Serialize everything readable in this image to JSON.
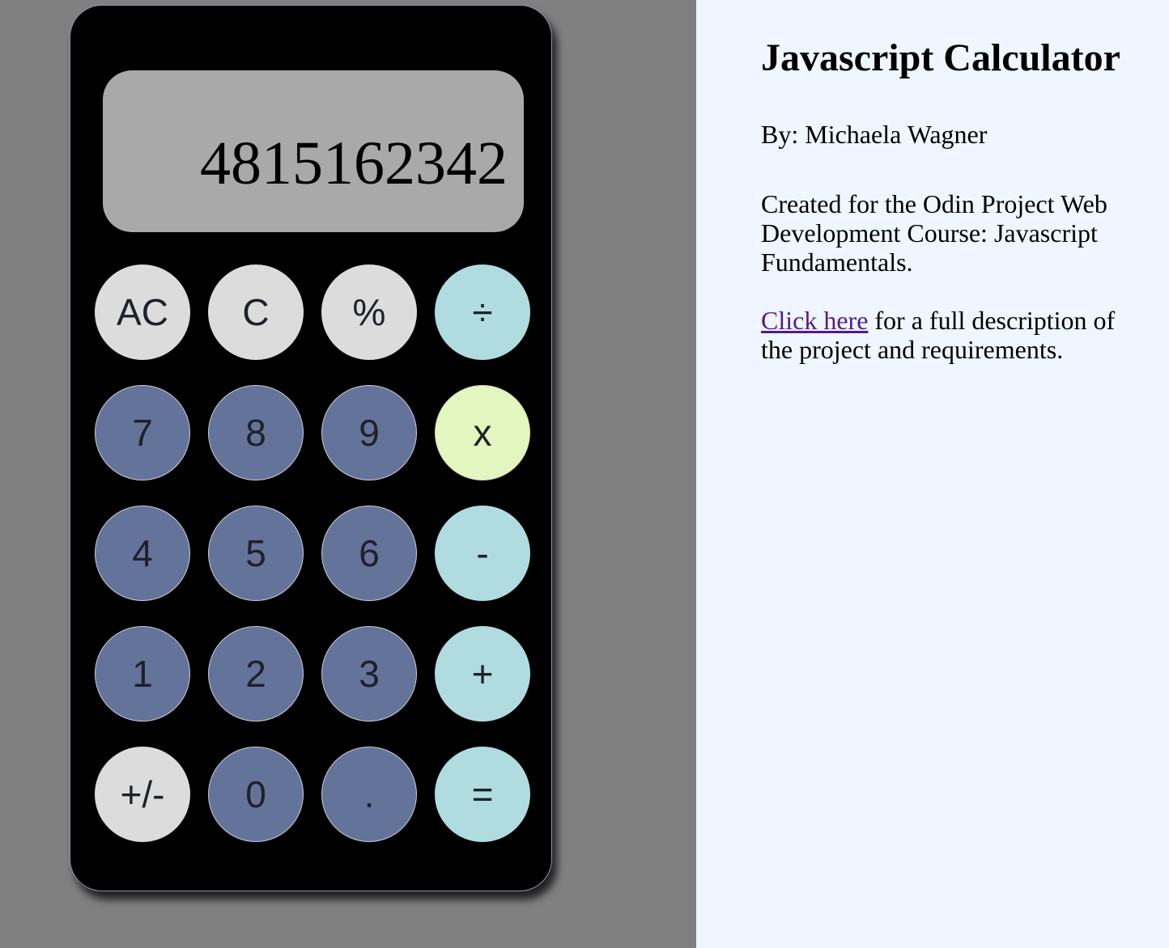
{
  "calculator": {
    "display_value": "4815162342",
    "keys": [
      {
        "label": "AC",
        "type": "func",
        "name": "all-clear-button"
      },
      {
        "label": "C",
        "type": "func",
        "name": "clear-button"
      },
      {
        "label": "%",
        "type": "func",
        "name": "percent-button"
      },
      {
        "label": "÷",
        "type": "op",
        "name": "divide-button"
      },
      {
        "label": "7",
        "type": "num",
        "name": "digit-7-button"
      },
      {
        "label": "8",
        "type": "num",
        "name": "digit-8-button"
      },
      {
        "label": "9",
        "type": "num",
        "name": "digit-9-button"
      },
      {
        "label": "x",
        "type": "op-active",
        "name": "multiply-button"
      },
      {
        "label": "4",
        "type": "num",
        "name": "digit-4-button"
      },
      {
        "label": "5",
        "type": "num",
        "name": "digit-5-button"
      },
      {
        "label": "6",
        "type": "num",
        "name": "digit-6-button"
      },
      {
        "label": "-",
        "type": "op",
        "name": "subtract-button"
      },
      {
        "label": "1",
        "type": "num",
        "name": "digit-1-button"
      },
      {
        "label": "2",
        "type": "num",
        "name": "digit-2-button"
      },
      {
        "label": "3",
        "type": "num",
        "name": "digit-3-button"
      },
      {
        "label": "+",
        "type": "op",
        "name": "add-button"
      },
      {
        "label": "+/-",
        "type": "func",
        "name": "sign-toggle-button"
      },
      {
        "label": "0",
        "type": "num",
        "name": "digit-0-button"
      },
      {
        "label": ".",
        "type": "num",
        "name": "decimal-button"
      },
      {
        "label": "=",
        "type": "op",
        "name": "equals-button"
      }
    ]
  },
  "info": {
    "title": "Javascript Calculator",
    "byline": "By: Michaela Wagner",
    "description": "Created for the Odin Project Web Development Course: Javascript Fundamentals.",
    "link_text": "Click here",
    "link_suffix": " for a full description of the project and requirements."
  },
  "colors": {
    "page_left_bg": "#808080",
    "page_right_bg": "#eff6ff",
    "calculator_body": "#000000",
    "display_bg": "#a9a9a9",
    "function_key": "#dcdcdc",
    "number_key": "#64739a",
    "operator_key": "#b0dce0",
    "active_operator_key": "#e4f6c0",
    "link": "#551a8b"
  }
}
